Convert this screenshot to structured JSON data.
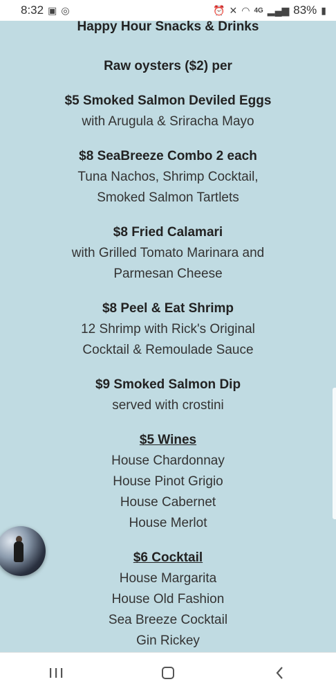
{
  "status_bar": {
    "time": "8:32",
    "battery": "83%",
    "network": "4G"
  },
  "page": {
    "title": "Happy Hour Snacks & Drinks"
  },
  "menu": {
    "sections": [
      {
        "title": "Raw oysters ($2) per",
        "underline": false,
        "lines": []
      },
      {
        "title": "$5 Smoked Salmon Deviled Eggs",
        "underline": false,
        "lines": [
          "with Arugula & Sriracha Mayo"
        ]
      },
      {
        "title": "$8 SeaBreeze Combo 2 each",
        "underline": false,
        "lines": [
          "Tuna Nachos, Shrimp Cocktail,",
          "Smoked Salmon Tartlets"
        ]
      },
      {
        "title": "$8 Fried Calamari",
        "underline": false,
        "lines": [
          "with Grilled Tomato Marinara and",
          "Parmesan Cheese"
        ]
      },
      {
        "title": "$8 Peel & Eat Shrimp",
        "underline": false,
        "lines": [
          "12 Shrimp with Rick's Original",
          "Cocktail & Remoulade Sauce"
        ]
      },
      {
        "title": "$9 Smoked Salmon Dip",
        "underline": false,
        "lines": [
          "served with crostini"
        ]
      },
      {
        "title": "$5 Wines",
        "underline": true,
        "lines": [
          "House Chardonnay",
          "House Pinot Grigio",
          "House Cabernet",
          "House Merlot"
        ]
      },
      {
        "title": "$6 Cocktail",
        "underline": true,
        "lines": [
          "House Margarita",
          "House Old Fashion",
          "Sea Breeze Cocktail",
          "Gin Rickey"
        ]
      }
    ]
  },
  "nav": {
    "recents": "recent-apps-icon",
    "home": "home-icon",
    "back": "back-icon"
  },
  "colors": {
    "background": "#c0dbe2",
    "text": "#222222"
  }
}
